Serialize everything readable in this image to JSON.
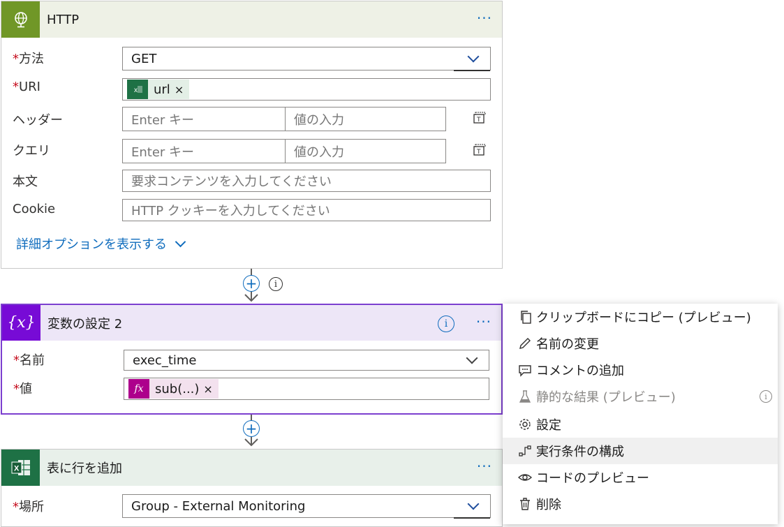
{
  "http_card": {
    "title": "HTTP",
    "more": "···",
    "method": {
      "label": "方法",
      "value": "GET"
    },
    "uri": {
      "label": "URI",
      "token": "url"
    },
    "headers": {
      "label": "ヘッダー",
      "key_placeholder": "Enter キー",
      "value_placeholder": "値の入力"
    },
    "queries": {
      "label": "クエリ",
      "key_placeholder": "Enter キー",
      "value_placeholder": "値の入力"
    },
    "body": {
      "label": "本文",
      "placeholder": "要求コンテンツを入力してください"
    },
    "cookie": {
      "label": "Cookie",
      "placeholder": "HTTP クッキーを入力してください"
    },
    "advanced_link": "詳細オプションを表示する"
  },
  "variable_card": {
    "title": "変数の設定 2",
    "icon_text": "{x}",
    "more": "···",
    "name": {
      "label": "名前",
      "value": "exec_time"
    },
    "value": {
      "label": "値",
      "token": "sub(...)"
    }
  },
  "excel_card": {
    "title": "表に行を追加",
    "more": "···",
    "location": {
      "label": "場所",
      "value": "Group - External Monitoring"
    }
  },
  "required_marker": "*",
  "token_remove": "×",
  "context_menu": [
    {
      "label": "クリップボードにコピー (プレビュー)",
      "icon": "copy-icon",
      "disabled": false
    },
    {
      "label": "名前の変更",
      "icon": "pencil-icon",
      "disabled": false
    },
    {
      "label": "コメントの追加",
      "icon": "comment-icon",
      "disabled": false
    },
    {
      "label": "静的な結果 (プレビュー)",
      "icon": "flask-icon",
      "disabled": true
    },
    {
      "label": "設定",
      "icon": "gear-icon",
      "disabled": false
    },
    {
      "label": "実行条件の構成",
      "icon": "run-after-icon",
      "disabled": false,
      "hovered": true
    },
    {
      "label": "コードのプレビュー",
      "icon": "eye-icon",
      "disabled": false
    },
    {
      "label": "削除",
      "icon": "trash-icon",
      "disabled": false
    }
  ],
  "colors": {
    "http_header_bg": "#eef1e6",
    "http_icon_bg": "#709727",
    "variable_header_bg": "#ede6f7",
    "variable_icon_bg": "#770bd6",
    "variable_border": "#7c3fcf",
    "excel_header_bg": "#e8f0ea",
    "excel_icon_bg": "#1e7145",
    "link_blue": "#0f6cbd",
    "token_excel_bg": "#e3efe6",
    "token_fx_bg": "#f3e1ee",
    "token_fx_icon": "#ad008c"
  }
}
